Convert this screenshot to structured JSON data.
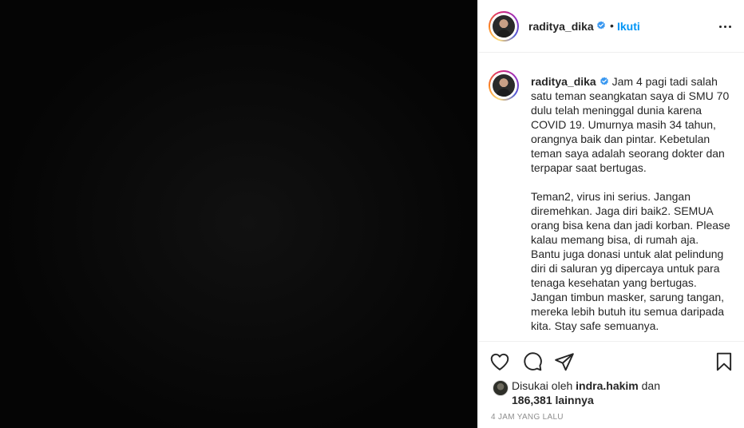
{
  "post": {
    "username": "raditya_dika",
    "follow_label": "Ikuti",
    "separator": "•",
    "caption": "Jam 4 pagi tadi salah satu teman seangkatan saya di SMU 70 dulu telah meninggal dunia karena COVID 19. Umurnya masih 34 tahun, orangnya baik dan pintar. Kebetulan teman saya adalah seorang dokter dan terpapar saat bertugas.\n\nTeman2, virus ini serius. Jangan diremehkan. Jaga diri baik2. SEMUA orang bisa kena dan jadi korban. Please kalau memang bisa, di rumah aja.\nBantu juga donasi untuk alat pelindung diri di saluran yg dipercaya untuk para tenaga kesehatan yang bertugas.\nJangan timbun masker, sarung tangan, mereka lebih butuh itu semua daripada kita. Stay safe semuanya.",
    "likes": {
      "prefix": "Disukai oleh",
      "liker": "indra.hakim",
      "connector": "dan",
      "others": "186,381 lainnya"
    },
    "timestamp": "4 JAM YANG LALU"
  },
  "icons": {
    "verified": "verified-badge-icon",
    "more": "more-options-icon",
    "like": "heart-icon",
    "comment": "comment-icon",
    "share": "share-icon",
    "save": "bookmark-icon"
  },
  "colors": {
    "accent": "#0095f6",
    "text": "#262626",
    "muted": "#8e8e8e",
    "media_bg": "#050505"
  }
}
